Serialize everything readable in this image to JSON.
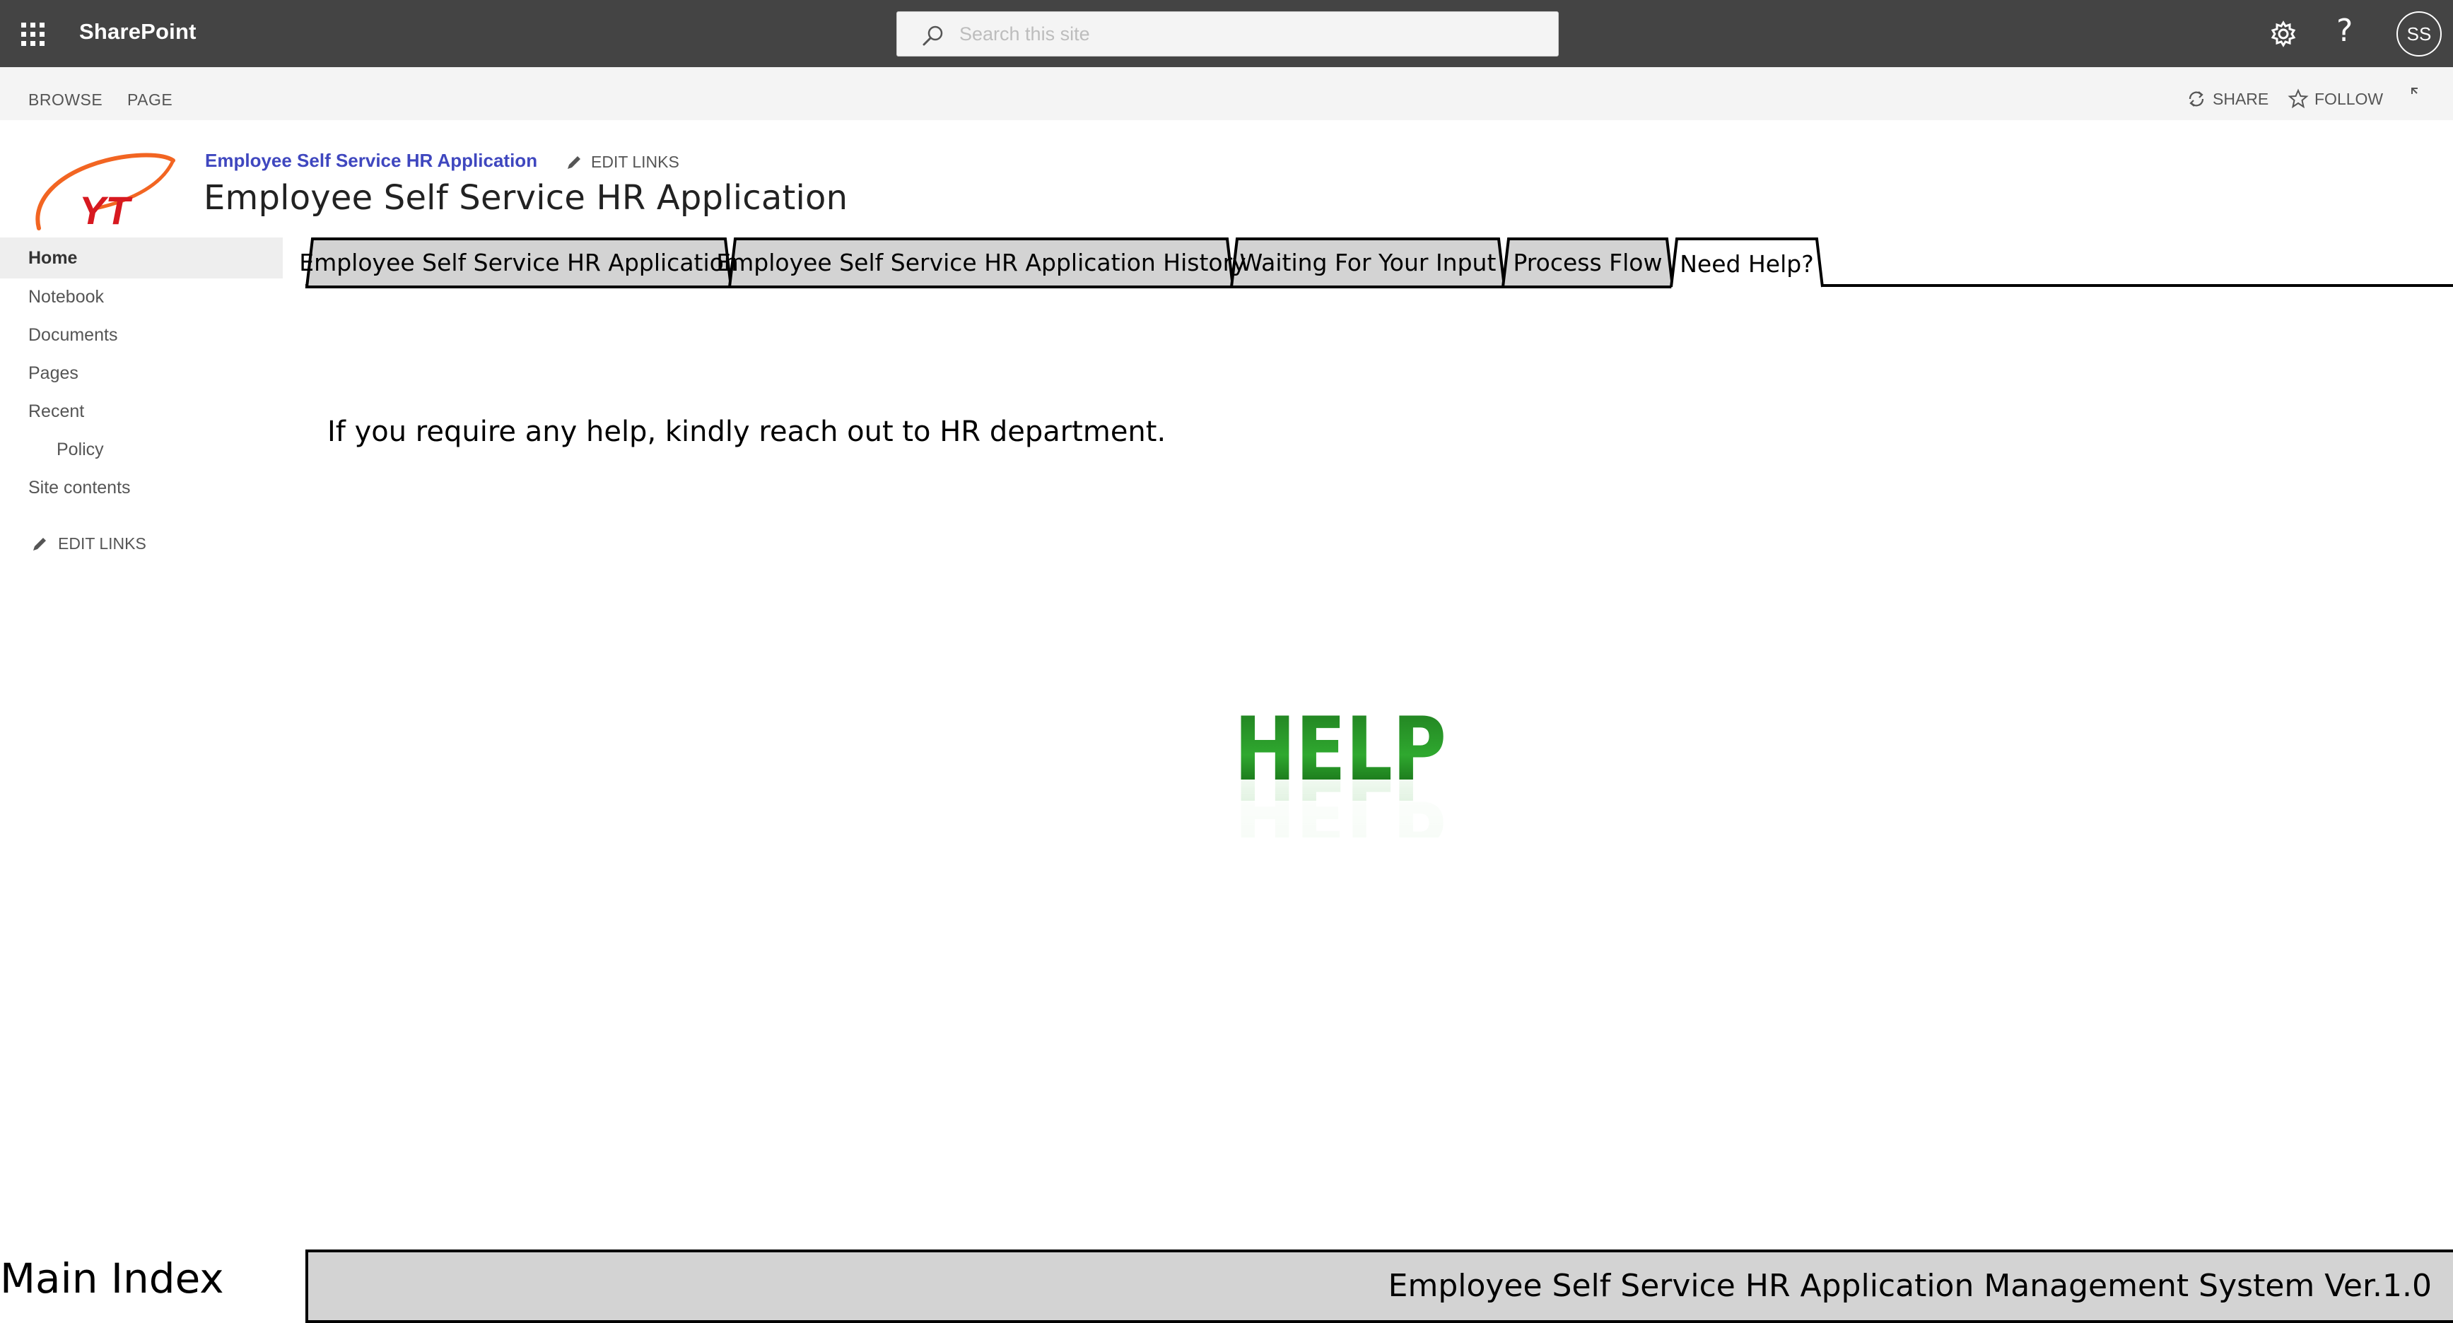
{
  "suite_bar": {
    "brand": "SharePoint",
    "search_placeholder": "Search this site",
    "help_symbol": "?",
    "avatar_initials": "SS",
    "icons": [
      "app-launcher-icon",
      "search-icon",
      "gear-icon",
      "help-icon"
    ]
  },
  "ribbon": {
    "tabs": [
      "BROWSE",
      "PAGE"
    ],
    "share_label": "SHARE",
    "follow_label": "FOLLOW",
    "icons": [
      "share-icon",
      "star-icon",
      "focus-mode-icon"
    ]
  },
  "header": {
    "site_link": "Employee Self Service HR Application",
    "edit_links_label": "EDIT LINKS",
    "site_title": "Employee Self Service HR Application",
    "logo_text": "YT"
  },
  "leftnav": {
    "items": [
      {
        "label": "Home",
        "active": true
      },
      {
        "label": "Notebook"
      },
      {
        "label": "Documents"
      },
      {
        "label": "Pages"
      },
      {
        "label": "Recent"
      },
      {
        "label": "Policy"
      },
      {
        "label": "Site contents"
      }
    ],
    "edit_links_label": "EDIT LINKS"
  },
  "tabs": [
    {
      "label": "Employee Self Service HR Application",
      "active": false
    },
    {
      "label": "Employee Self Service HR Application History",
      "active": false
    },
    {
      "label": "Waiting For Your Input",
      "active": false
    },
    {
      "label": "Process Flow",
      "active": false
    },
    {
      "label": "Need Help?",
      "active": true
    }
  ],
  "content": {
    "message": "If you require any help, kindly reach out to HR department.",
    "graphic_text": "HELP"
  },
  "footer": {
    "title": "Main Index",
    "system_label": "Employee Self Service HR Application Management System Ver.1.0"
  },
  "colors": {
    "suite_bar_bg": "#444444",
    "ribbon_bg": "#f4f4f4",
    "link_blue": "#3f47bf",
    "tab_inactive_fill": "#d3d3d3",
    "help_green": "#2e8b2e",
    "logo_orange": "#f26522",
    "logo_red": "#d71920"
  }
}
